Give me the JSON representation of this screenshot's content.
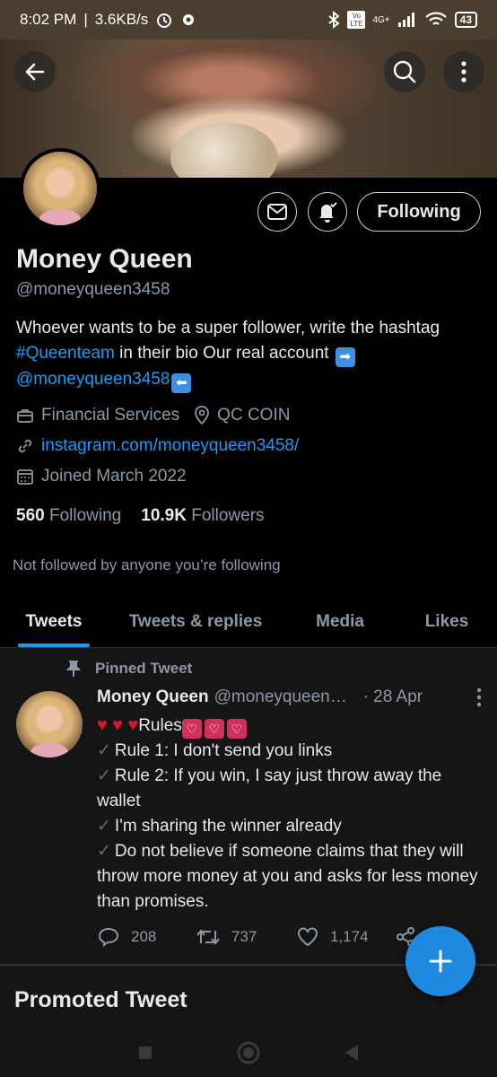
{
  "status_bar": {
    "time": "8:02 PM",
    "net_speed": "3.6KB/s",
    "battery": "43",
    "network": "4G+",
    "volte": "Vo LTE"
  },
  "header": {
    "back_icon": "arrow-left-icon",
    "search_icon": "search-icon",
    "more_icon": "more-vertical-icon"
  },
  "profile": {
    "following_button": "Following",
    "name": "Money Queen",
    "handle": "@moneyqueen3458",
    "bio_part1": "Whoever wants to be a super follower, write the hashtag ",
    "bio_hashtag": "#Queenteam",
    "bio_part2": " in their bio Our real account ",
    "bio_mention": "@moneyqueen3458",
    "category": "Financial Services",
    "location": "QC COIN",
    "website": "instagram.com/moneyqueen3458/",
    "joined": "Joined March 2022",
    "following_count": "560",
    "following_label": "Following",
    "followers_count": "10.9K",
    "followers_label": "Followers",
    "not_followed": "Not followed by anyone you’re following"
  },
  "tabs": [
    {
      "label": "Tweets",
      "active": true
    },
    {
      "label": "Tweets & replies",
      "active": false
    },
    {
      "label": "Media",
      "active": false
    },
    {
      "label": "Likes",
      "active": false
    }
  ],
  "pinned_tweet": {
    "pinned_label": "Pinned Tweet",
    "author_name": "Money Queen",
    "author_handle": "@moneyqueen3...",
    "date": "· 28 Apr",
    "rules_label": "Rules",
    "lines": [
      "Rule 1: I don't send you links",
      "Rule 2: If you win, I say just throw away the wallet",
      "I'm sharing the winner already",
      "Do not believe if someone claims that they will throw more money at you and asks for less money than promises."
    ],
    "replies": "208",
    "retweets": "737",
    "likes": "1,174"
  },
  "promoted": {
    "title": "Promoted Tweet"
  },
  "colors": {
    "accent": "#1d9bf0",
    "background": "#000000",
    "feed_background": "#151515",
    "muted_text": "#8b98a5"
  }
}
